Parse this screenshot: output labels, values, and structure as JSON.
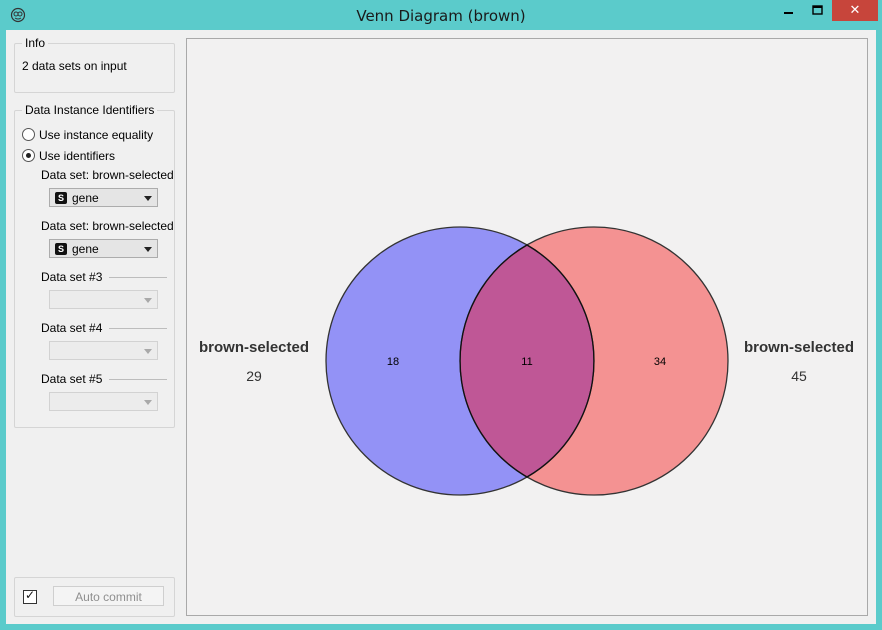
{
  "window": {
    "title": "Venn Diagram (brown)",
    "icon": "orange-app-icon",
    "controls": {
      "minimize": "—",
      "maximize": "☐",
      "close": "✕"
    }
  },
  "sidebar": {
    "info": {
      "title": "Info",
      "text": "2 data sets on input"
    },
    "identifiers": {
      "title": "Data Instance Identifiers",
      "options": [
        {
          "label": "Use instance equality",
          "checked": false
        },
        {
          "label": "Use identifiers",
          "checked": true
        }
      ],
      "datasets": [
        {
          "label": "Data set: brown-selected",
          "value": "gene",
          "icon": "S",
          "enabled": true
        },
        {
          "label": "Data set: brown-selected",
          "value": "gene",
          "icon": "S",
          "enabled": true
        },
        {
          "label": "Data set #3",
          "value": "",
          "enabled": false
        },
        {
          "label": "Data set #4",
          "value": "",
          "enabled": false
        },
        {
          "label": "Data set #5",
          "value": "",
          "enabled": false
        }
      ]
    },
    "commit": {
      "checked": true,
      "label": "Auto commit"
    }
  },
  "venn": {
    "sets": [
      {
        "name": "brown-selected",
        "size": "29",
        "color": "#7b7bf7"
      },
      {
        "name": "brown-selected",
        "size": "45",
        "color": "#f47a7a"
      }
    ],
    "regions": {
      "left_only": "18",
      "intersection": "11",
      "right_only": "34"
    },
    "intersection_color": "#bf5796"
  }
}
